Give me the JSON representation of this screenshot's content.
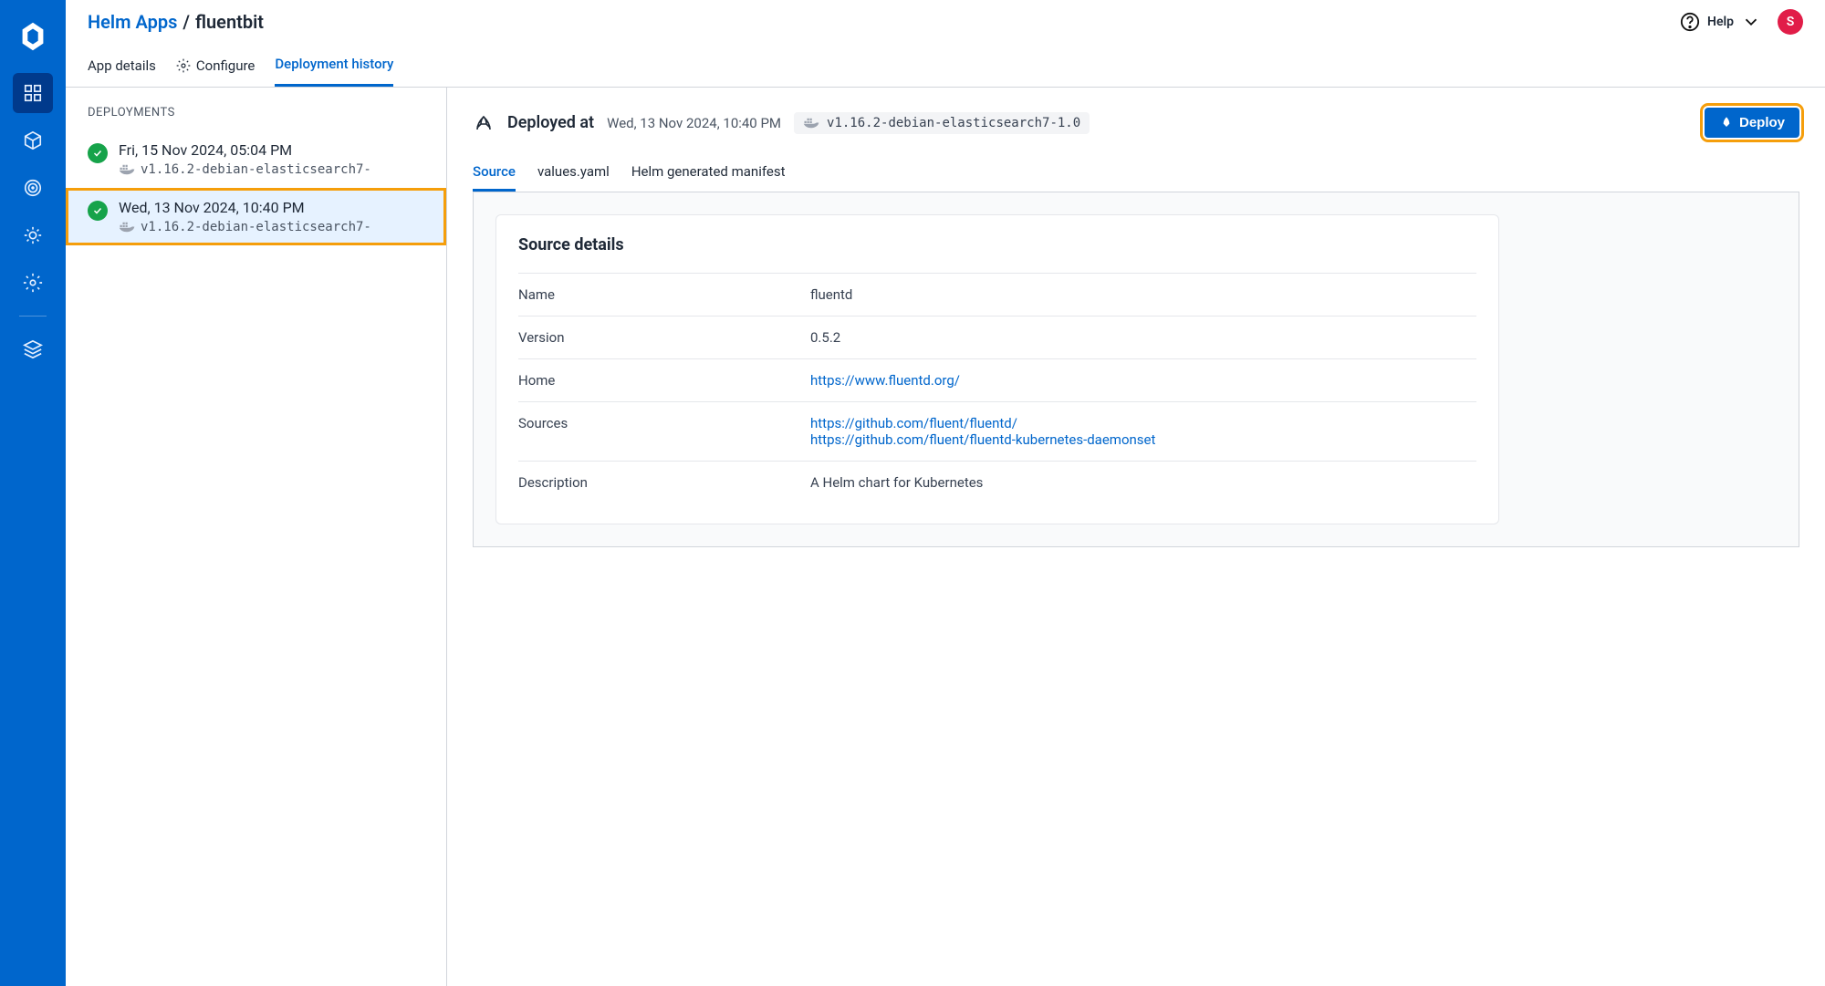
{
  "header": {
    "breadcrumb_root": "Helm Apps",
    "breadcrumb_current": "fluentbit",
    "help_label": "Help",
    "avatar_letter": "S"
  },
  "app_tabs": [
    {
      "label": "App details",
      "active": false,
      "has_icon": false
    },
    {
      "label": "Configure",
      "active": false,
      "has_icon": true
    },
    {
      "label": "Deployment history",
      "active": true,
      "has_icon": false
    }
  ],
  "deployments": {
    "header": "DEPLOYMENTS",
    "items": [
      {
        "date": "Fri, 15 Nov 2024, 05:04 PM",
        "version": "v1.16.2-debian-elasticsearch7-",
        "selected": false
      },
      {
        "date": "Wed, 13 Nov 2024, 10:40 PM",
        "version": "v1.16.2-debian-elasticsearch7-",
        "selected": true
      }
    ]
  },
  "detail": {
    "deployed_at_label": "Deployed at",
    "deployed_at_value": "Wed, 13 Nov 2024, 10:40 PM",
    "version_chip": "v1.16.2-debian-elasticsearch7-1.0",
    "deploy_button": "Deploy",
    "sub_tabs": [
      {
        "label": "Source",
        "active": true
      },
      {
        "label": "values.yaml",
        "active": false
      },
      {
        "label": "Helm generated manifest",
        "active": false
      }
    ],
    "source_card": {
      "title": "Source details",
      "rows": [
        {
          "key": "Name",
          "type": "text",
          "value": "fluentd"
        },
        {
          "key": "Version",
          "type": "text",
          "value": "0.5.2"
        },
        {
          "key": "Home",
          "type": "link",
          "value": "https://www.fluentd.org/"
        },
        {
          "key": "Sources",
          "type": "links",
          "values": [
            "https://github.com/fluent/fluentd/",
            "https://github.com/fluent/fluentd-kubernetes-daemonset"
          ]
        },
        {
          "key": "Description",
          "type": "text",
          "value": "A Helm chart for Kubernetes"
        }
      ]
    }
  }
}
